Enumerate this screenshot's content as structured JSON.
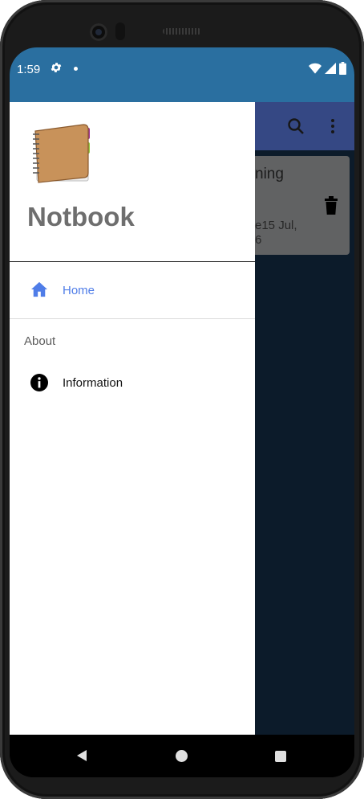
{
  "status_bar": {
    "time": "1:59",
    "color": "#2a6fa0",
    "icons": [
      "gear-icon",
      "dot-icon",
      "wifi-icon",
      "signal-icon",
      "battery-icon"
    ]
  },
  "background_app": {
    "toolbar_color": "#4e6ac3",
    "toolbar_icons": [
      "search-icon",
      "more-vert-icon"
    ],
    "note_card": {
      "title_fragment": "ning",
      "date_fragment_line1": "e15 Jul,",
      "date_fragment_line2": "6",
      "action_icon": "delete-icon"
    },
    "fab_label": "+"
  },
  "drawer": {
    "app_name": "Notbook",
    "logo_icon": "notebook-icon",
    "items": [
      {
        "label": "Home",
        "icon": "home-icon",
        "selected": true
      }
    ],
    "section_title": "About",
    "section_items": [
      {
        "label": "Information",
        "icon": "info-icon"
      }
    ],
    "accent_color": "#4f7de8"
  },
  "nav_bar": {
    "buttons": [
      "back-icon",
      "home-circle-icon",
      "recents-icon"
    ]
  }
}
